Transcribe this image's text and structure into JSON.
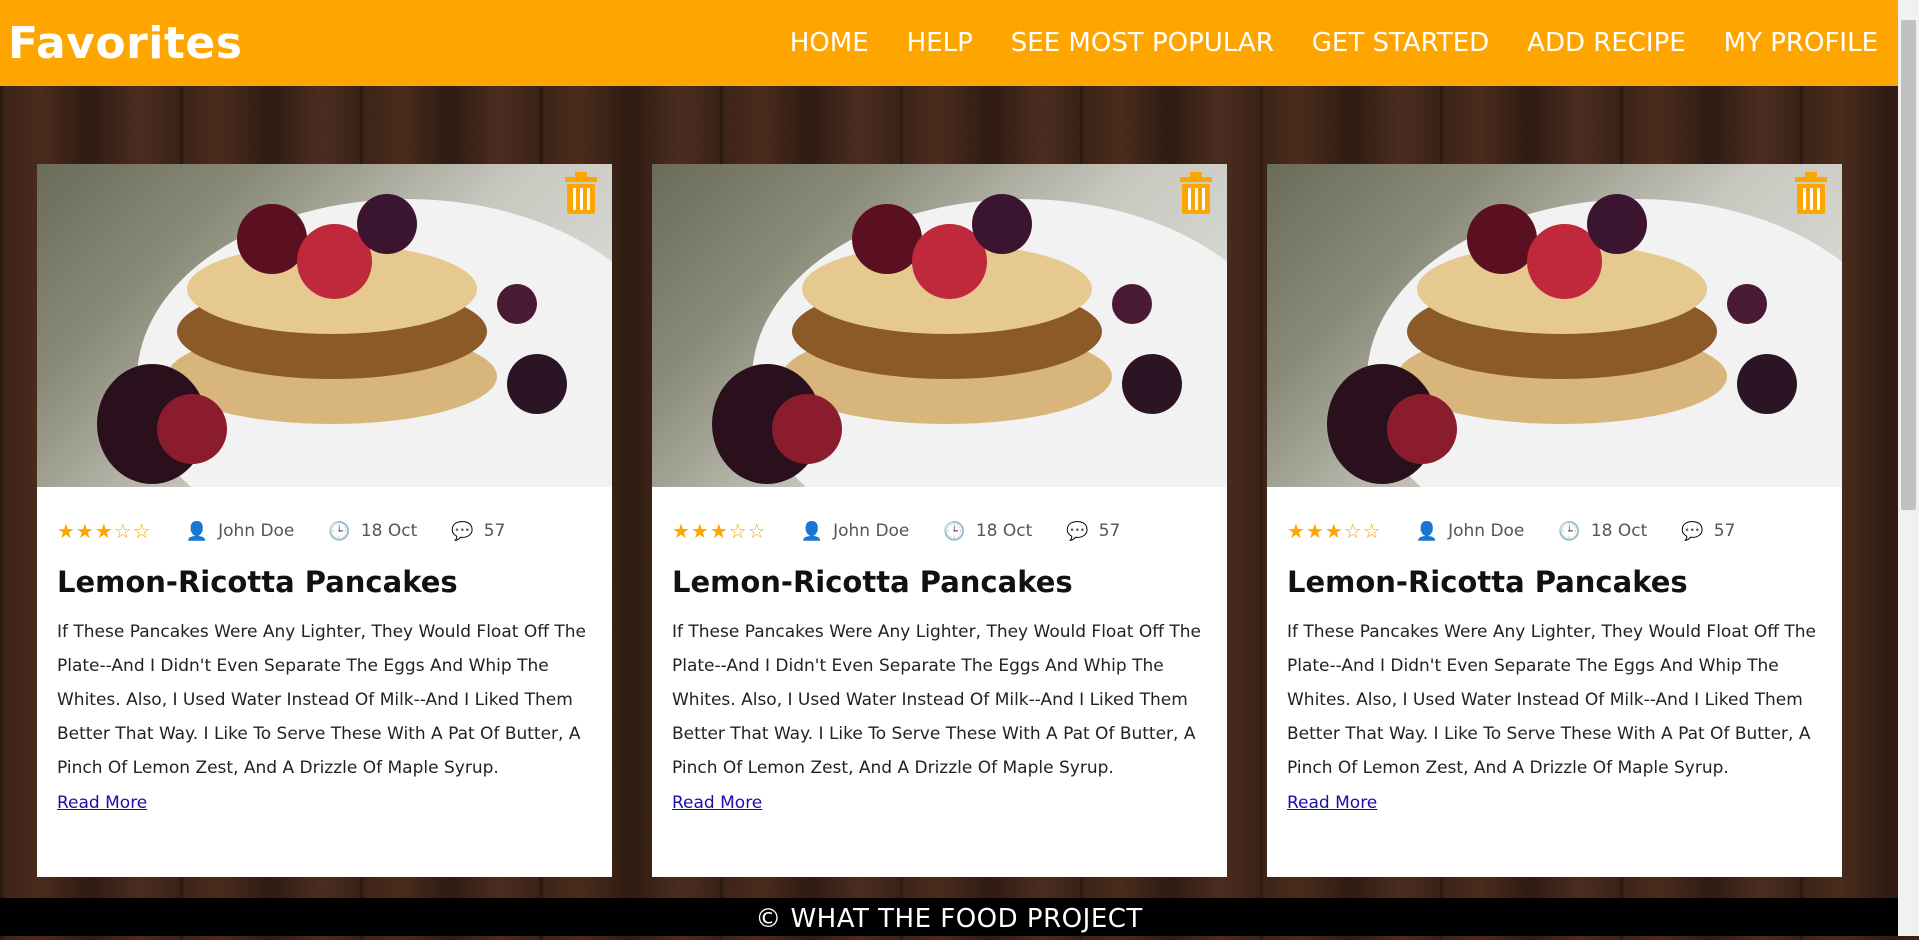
{
  "header": {
    "title": "Favorites",
    "nav": [
      "HOME",
      "HELP",
      "SEE MOST POPULAR",
      "GET STARTED",
      "ADD RECIPE",
      "MY PROFILE"
    ]
  },
  "colors": {
    "accent": "#ffa500",
    "footer_bg": "#000000",
    "link": "#1a0dab"
  },
  "cards": [
    {
      "rating": 3,
      "rating_max": 5,
      "author": "John Doe",
      "date": "18 Oct",
      "comments": "57",
      "title": "Lemon-Ricotta Pancakes",
      "description": "If These Pancakes Were Any Lighter, They Would Float Off The Plate--And I Didn't Even Separate The Eggs And Whip The Whites. Also, I Used Water Instead Of Milk--And I Liked Them Better That Way. I Like To Serve These With A Pat Of Butter, A Pinch Of Lemon Zest, And A Drizzle Of Maple Syrup.",
      "link": "Read More"
    },
    {
      "rating": 3,
      "rating_max": 5,
      "author": "John Doe",
      "date": "18 Oct",
      "comments": "57",
      "title": "Lemon-Ricotta Pancakes",
      "description": "If These Pancakes Were Any Lighter, They Would Float Off The Plate--And I Didn't Even Separate The Eggs And Whip The Whites. Also, I Used Water Instead Of Milk--And I Liked Them Better That Way. I Like To Serve These With A Pat Of Butter, A Pinch Of Lemon Zest, And A Drizzle Of Maple Syrup.",
      "link": "Read More"
    },
    {
      "rating": 3,
      "rating_max": 5,
      "author": "John Doe",
      "date": "18 Oct",
      "comments": "57",
      "title": "Lemon-Ricotta Pancakes",
      "description": "If These Pancakes Were Any Lighter, They Would Float Off The Plate--And I Didn't Even Separate The Eggs And Whip The Whites. Also, I Used Water Instead Of Milk--And I Liked Them Better That Way. I Like To Serve These With A Pat Of Butter, A Pinch Of Lemon Zest, And A Drizzle Of Maple Syrup.",
      "link": "Read More"
    }
  ],
  "footer": {
    "text": "© WHAT THE FOOD PROJECT"
  }
}
